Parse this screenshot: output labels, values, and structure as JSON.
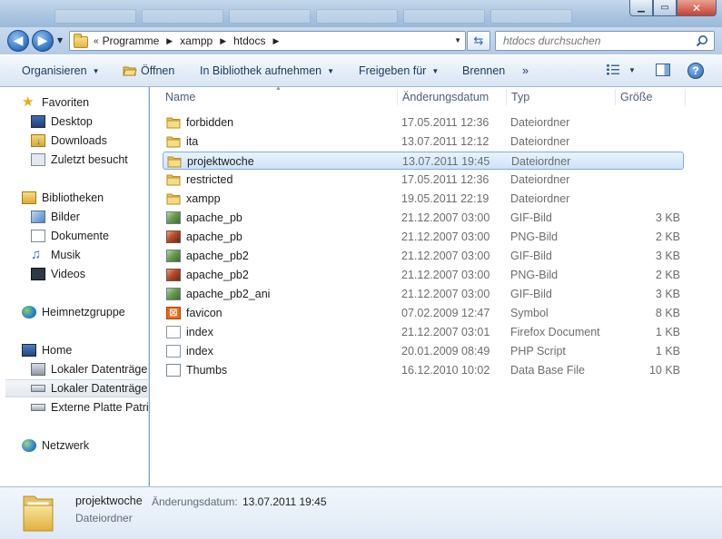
{
  "window": {
    "minimize": "▁",
    "maximize": "▭",
    "close": "✕"
  },
  "address": {
    "overflow": "«",
    "crumbs": [
      "Programme",
      "xampp",
      "htdocs"
    ]
  },
  "search": {
    "placeholder": "htdocs durchsuchen"
  },
  "toolbar": {
    "organize": "Organisieren",
    "open": "Öffnen",
    "library": "In Bibliothek aufnehmen",
    "share": "Freigeben für",
    "burn": "Brennen",
    "more": "»",
    "help": "?"
  },
  "nav": {
    "favorites": "Favoriten",
    "desktop": "Desktop",
    "downloads": "Downloads",
    "recent": "Zuletzt besucht",
    "libraries": "Bibliotheken",
    "pictures": "Bilder",
    "documents": "Dokumente",
    "music": "Musik",
    "videos": "Videos",
    "homegroup": "Heimnetzgruppe",
    "home": "Home",
    "drive1": "Lokaler Datenträger",
    "drive2": "Lokaler Datenträger",
    "external": "Externe Platte Patricl",
    "network": "Netzwerk"
  },
  "columns": {
    "name": "Name",
    "date": "Änderungsdatum",
    "type": "Typ",
    "size": "Größe"
  },
  "files": [
    {
      "name": "forbidden",
      "date": "17.05.2011 12:36",
      "type": "Dateiordner",
      "size": "",
      "icon": "folder-icon"
    },
    {
      "name": "ita",
      "date": "13.07.2011 12:12",
      "type": "Dateiordner",
      "size": "",
      "icon": "folder-icon"
    },
    {
      "name": "projektwoche",
      "date": "13.07.2011 19:45",
      "type": "Dateiordner",
      "size": "",
      "icon": "folder-icon"
    },
    {
      "name": "restricted",
      "date": "17.05.2011 12:36",
      "type": "Dateiordner",
      "size": "",
      "icon": "folder-icon"
    },
    {
      "name": "xampp",
      "date": "19.05.2011 22:19",
      "type": "Dateiordner",
      "size": "",
      "icon": "folder-icon"
    },
    {
      "name": "apache_pb",
      "date": "21.12.2007 03:00",
      "type": "GIF-Bild",
      "size": "3 KB",
      "icon": "gif-image-icon"
    },
    {
      "name": "apache_pb",
      "date": "21.12.2007 03:00",
      "type": "PNG-Bild",
      "size": "2 KB",
      "icon": "png-image-icon"
    },
    {
      "name": "apache_pb2",
      "date": "21.12.2007 03:00",
      "type": "GIF-Bild",
      "size": "3 KB",
      "icon": "gif-image-icon"
    },
    {
      "name": "apache_pb2",
      "date": "21.12.2007 03:00",
      "type": "PNG-Bild",
      "size": "2 KB",
      "icon": "png-image-icon"
    },
    {
      "name": "apache_pb2_ani",
      "date": "21.12.2007 03:00",
      "type": "GIF-Bild",
      "size": "3 KB",
      "icon": "gif-image-icon"
    },
    {
      "name": "favicon",
      "date": "07.02.2009 12:47",
      "type": "Symbol",
      "size": "8 KB",
      "icon": "favicon-icon"
    },
    {
      "name": "index",
      "date": "21.12.2007 03:01",
      "type": "Firefox Document",
      "size": "1 KB",
      "icon": "document-icon"
    },
    {
      "name": "index",
      "date": "20.01.2009 08:49",
      "type": "PHP Script",
      "size": "1 KB",
      "icon": "script-icon"
    },
    {
      "name": "Thumbs",
      "date": "16.12.2010 10:02",
      "type": "Data Base File",
      "size": "10 KB",
      "icon": "database-icon"
    }
  ],
  "details": {
    "name": "projektwoche",
    "date_label": "Änderungsdatum:",
    "date_value": "13.07.2011 19:45",
    "type": "Dateiordner"
  }
}
